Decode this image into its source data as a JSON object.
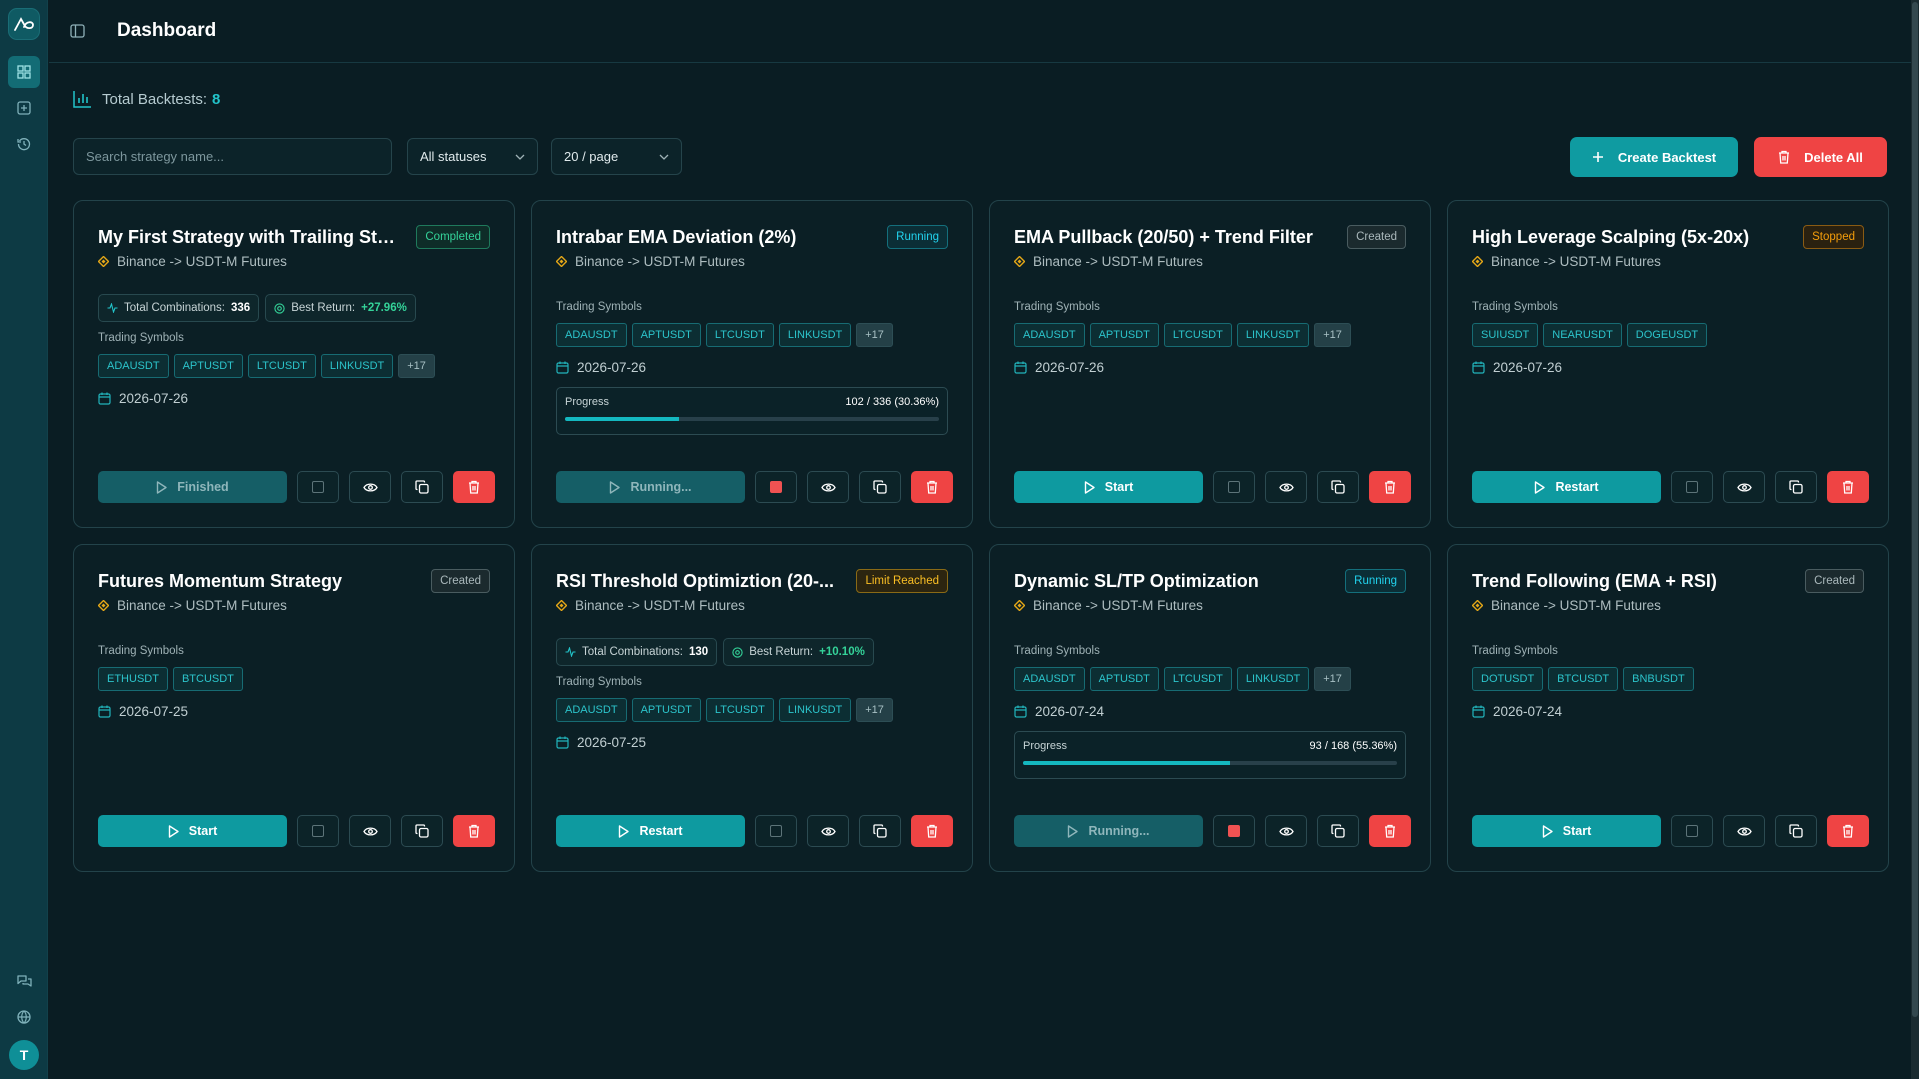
{
  "header": {
    "title": "Dashboard"
  },
  "summary": {
    "label": "Total Backtests:",
    "count": "8"
  },
  "filters": {
    "search_placeholder": "Search strategy name...",
    "status": "All statuses",
    "page_size": "20 / page",
    "create_label": "Create Backtest",
    "delete_all_label": "Delete All"
  },
  "user": {
    "initial": "T"
  },
  "labels": {
    "trading_symbols": "Trading Symbols",
    "total_combinations": "Total Combinations:",
    "best_return": "Best Return:",
    "progress": "Progress"
  },
  "colors": {
    "accent": "#0f9ba1",
    "danger": "#ef4444",
    "background": "#0a1d23"
  },
  "cards": [
    {
      "title": "My First Strategy with Trailing Stop",
      "status": "Completed",
      "status_kind": "completed",
      "exchange": "Binance -> USDT-M Futures",
      "stats": {
        "combinations": "336",
        "best_return": "+27.96%"
      },
      "symbols": [
        "ADAUSDT",
        "APTUSDT",
        "LTCUSDT",
        "LINKUSDT"
      ],
      "more": "+17",
      "date": "2026-07-26",
      "action": "Finished",
      "action_dim": true,
      "stop_active": false
    },
    {
      "title": "Intrabar EMA Deviation (2%)",
      "status": "Running",
      "status_kind": "running",
      "exchange": "Binance -> USDT-M Futures",
      "symbols": [
        "ADAUSDT",
        "APTUSDT",
        "LTCUSDT",
        "LINKUSDT"
      ],
      "more": "+17",
      "date": "2026-07-26",
      "progress": {
        "text": "102 / 336 (30.36%)",
        "fraction": 0.3036
      },
      "action": "Running...",
      "action_dim": true,
      "stop_active": true
    },
    {
      "title": "EMA Pullback (20/50) + Trend Filter",
      "status": "Created",
      "status_kind": "created",
      "exchange": "Binance -> USDT-M Futures",
      "symbols": [
        "ADAUSDT",
        "APTUSDT",
        "LTCUSDT",
        "LINKUSDT"
      ],
      "more": "+17",
      "date": "2026-07-26",
      "action": "Start",
      "action_dim": false,
      "stop_active": false
    },
    {
      "title": "High Leverage Scalping (5x-20x)",
      "status": "Stopped",
      "status_kind": "stopped",
      "exchange": "Binance -> USDT-M Futures",
      "symbols": [
        "SUIUSDT",
        "NEARUSDT",
        "DOGEUSDT"
      ],
      "date": "2026-07-26",
      "action": "Restart",
      "action_dim": false,
      "stop_active": false
    },
    {
      "title": "Futures Momentum Strategy",
      "status": "Created",
      "status_kind": "created",
      "exchange": "Binance -> USDT-M Futures",
      "symbols": [
        "ETHUSDT",
        "BTCUSDT"
      ],
      "date": "2026-07-25",
      "action": "Start",
      "action_dim": false,
      "stop_active": false
    },
    {
      "title": "RSI Threshold Optimiztion (20-...",
      "status": "Limit Reached",
      "status_kind": "limit",
      "exchange": "Binance -> USDT-M Futures",
      "stats": {
        "combinations": "130",
        "best_return": "+10.10%"
      },
      "symbols": [
        "ADAUSDT",
        "APTUSDT",
        "LTCUSDT",
        "LINKUSDT"
      ],
      "more": "+17",
      "date": "2026-07-25",
      "action": "Restart",
      "action_dim": false,
      "stop_active": false
    },
    {
      "title": "Dynamic SL/TP Optimization",
      "status": "Running",
      "status_kind": "running",
      "exchange": "Binance -> USDT-M Futures",
      "symbols": [
        "ADAUSDT",
        "APTUSDT",
        "LTCUSDT",
        "LINKUSDT"
      ],
      "more": "+17",
      "date": "2026-07-24",
      "progress": {
        "text": "93 / 168 (55.36%)",
        "fraction": 0.5536
      },
      "action": "Running...",
      "action_dim": true,
      "stop_active": true
    },
    {
      "title": "Trend Following (EMA + RSI)",
      "status": "Created",
      "status_kind": "created",
      "exchange": "Binance -> USDT-M Futures",
      "symbols": [
        "DOTUSDT",
        "BTCUSDT",
        "BNBUSDT"
      ],
      "date": "2026-07-24",
      "action": "Start",
      "action_dim": false,
      "stop_active": false
    }
  ]
}
